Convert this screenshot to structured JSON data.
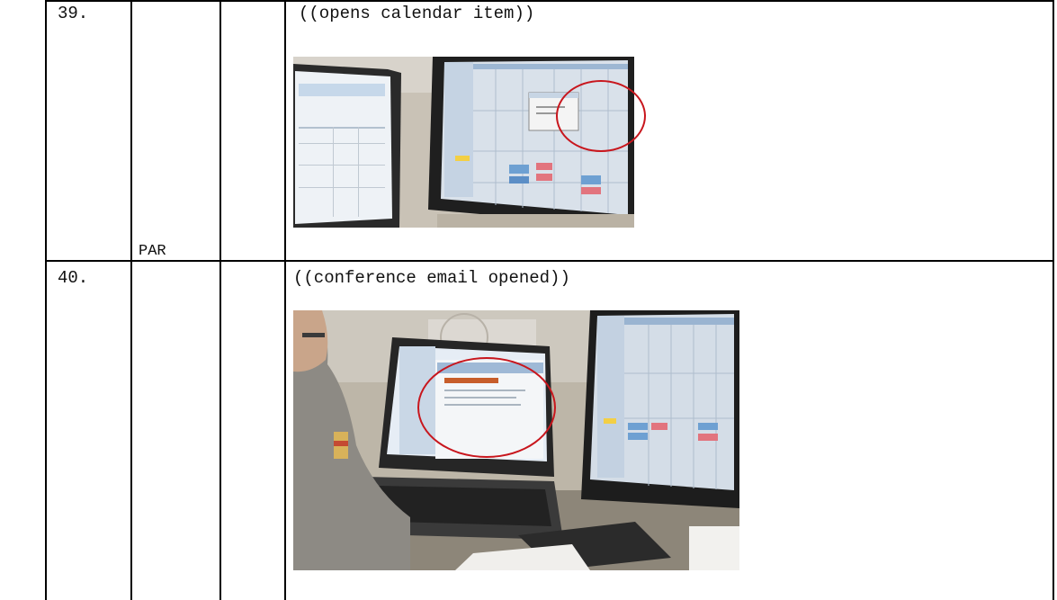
{
  "rows": [
    {
      "number": "39.",
      "speaker": "PAR",
      "annotation": "((opens calendar item))",
      "photo_icon": "photo-two-monitors-calendar",
      "highlight_color": "#c8161d"
    },
    {
      "number": "40.",
      "speaker": "",
      "annotation": "((conference email opened))",
      "photo_icon": "photo-man-at-laptop-email",
      "highlight_color": "#c8161d"
    }
  ]
}
